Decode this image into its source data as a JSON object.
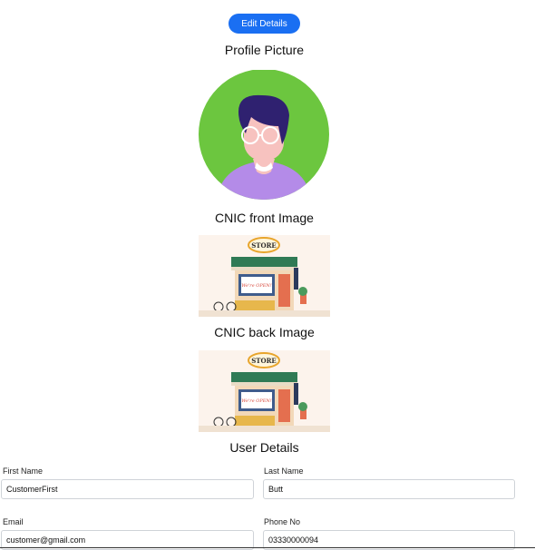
{
  "actions": {
    "edit_label": "Edit Details"
  },
  "sections": {
    "profile_title": "Profile Picture",
    "cnic_front_title": "CNIC front Image",
    "cnic_back_title": "CNIC back Image",
    "user_details_title": "User Details"
  },
  "store_sign": "STORE",
  "store_window_text": "We're OPEN!",
  "form": {
    "first_name": {
      "label": "First Name",
      "value": "CustomerFirst"
    },
    "last_name": {
      "label": "Last Name",
      "value": "Butt"
    },
    "email": {
      "label": "Email",
      "value": "customer@gmail.com"
    },
    "phone": {
      "label": "Phone No",
      "value": "03330000094"
    }
  },
  "colors": {
    "accent": "#1a6ff2",
    "avatar_bg": "#6cc63f",
    "shirt": "#b48be8",
    "store_awning": "#2f7a55"
  }
}
